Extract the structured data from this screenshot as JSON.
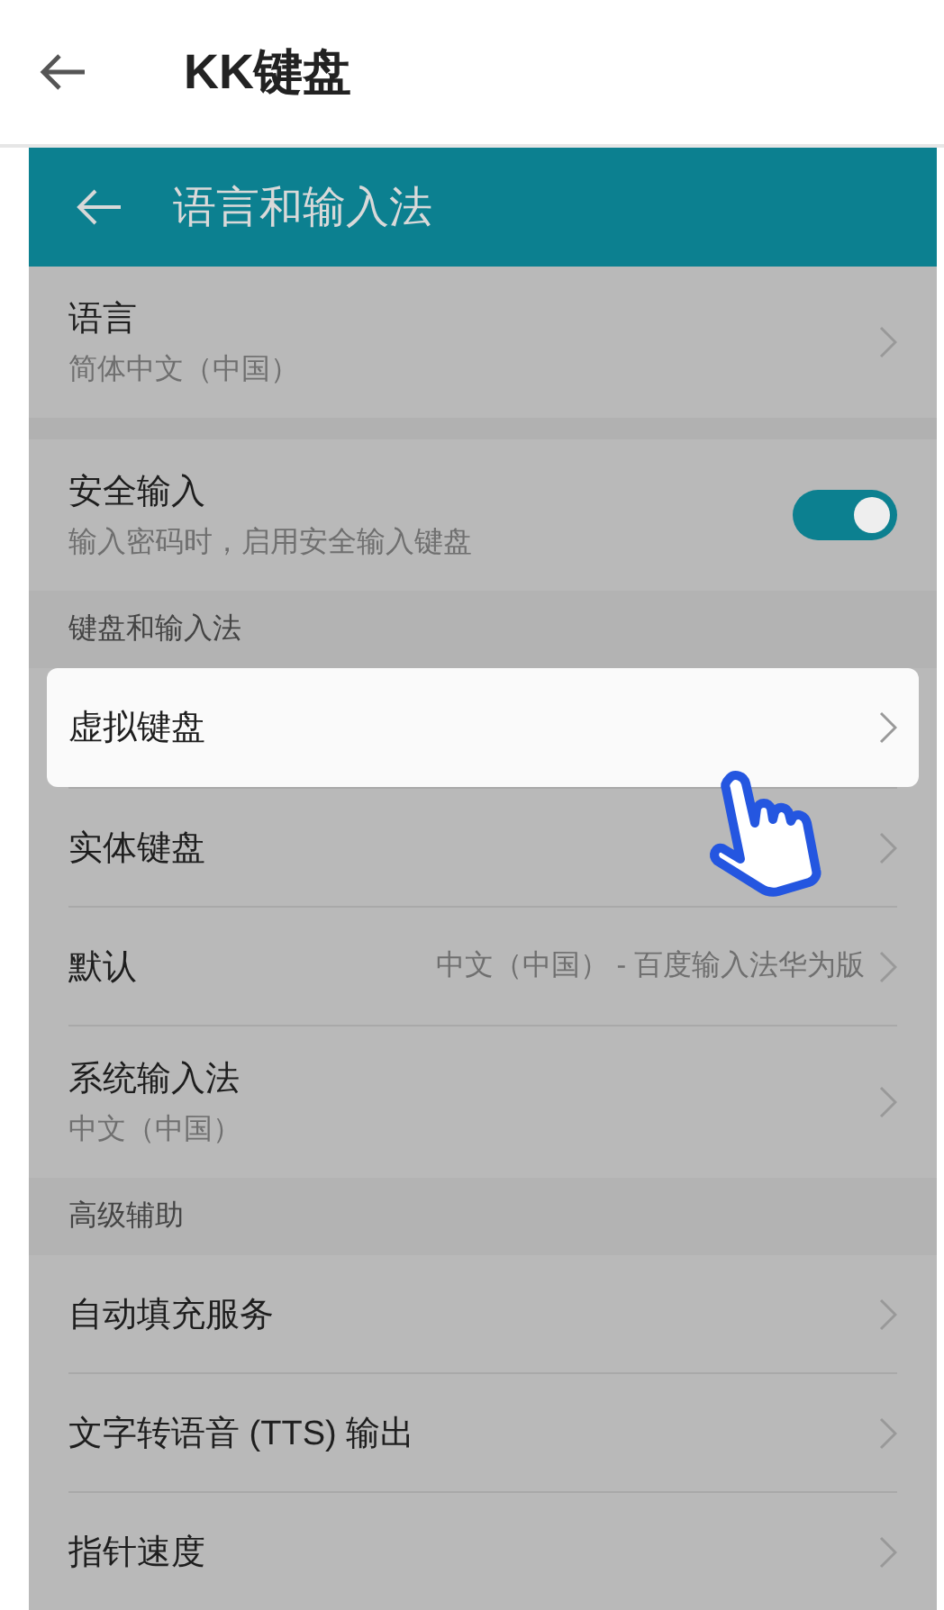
{
  "app_bar": {
    "title": "KK键盘"
  },
  "screenshot": {
    "title": "语言和输入法",
    "groups": [
      {
        "items": [
          {
            "kind": "nav",
            "title": "语言",
            "subtitle": "简体中文（中国）",
            "highlighted": false
          }
        ]
      },
      {
        "items": [
          {
            "kind": "switch",
            "title": "安全输入",
            "subtitle": "输入密码时，启用安全输入键盘",
            "on": true,
            "highlighted": false
          }
        ]
      },
      {
        "header": "键盘和输入法",
        "items": [
          {
            "kind": "nav",
            "title": "虚拟键盘",
            "highlighted": true
          },
          {
            "kind": "nav",
            "title": "实体键盘",
            "highlighted": false
          },
          {
            "kind": "nav",
            "title": "默认",
            "value": "中文（中国） - 百度输入法华为版",
            "highlighted": false
          },
          {
            "kind": "nav",
            "title": "系统输入法",
            "subtitle": "中文（中国）",
            "highlighted": false
          }
        ]
      },
      {
        "header": "高级辅助",
        "items": [
          {
            "kind": "nav",
            "title": "自动填充服务",
            "highlighted": false
          },
          {
            "kind": "nav",
            "title": "文字转语音 (TTS) 输出",
            "highlighted": false
          },
          {
            "kind": "nav",
            "title": "指针速度",
            "highlighted": false
          }
        ]
      }
    ]
  }
}
